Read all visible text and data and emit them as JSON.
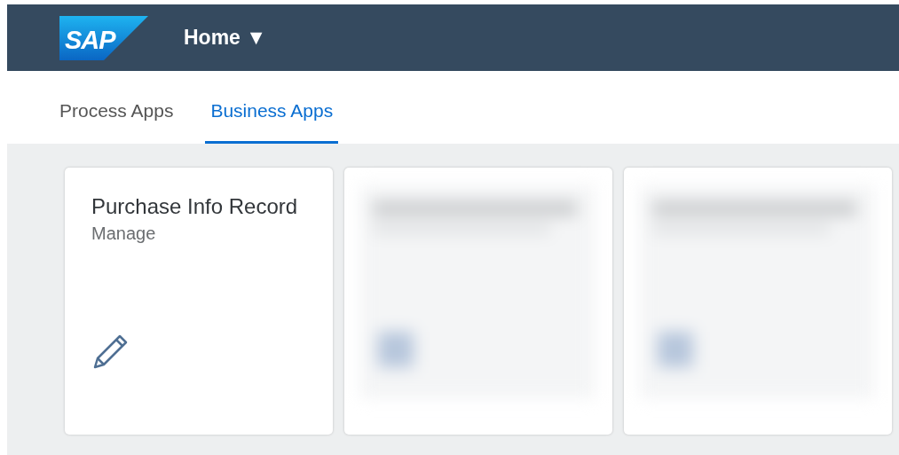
{
  "header": {
    "logo": "SAP",
    "title": "Home",
    "menu_caret": "▼"
  },
  "tabs": [
    {
      "label": "Process Apps",
      "selected": false
    },
    {
      "label": "Business Apps",
      "selected": true
    }
  ],
  "tiles": [
    {
      "kind": "app",
      "title": "Purchase Info Record",
      "subtitle": "Manage"
    },
    {
      "kind": "blurred"
    },
    {
      "kind": "blurred"
    }
  ]
}
